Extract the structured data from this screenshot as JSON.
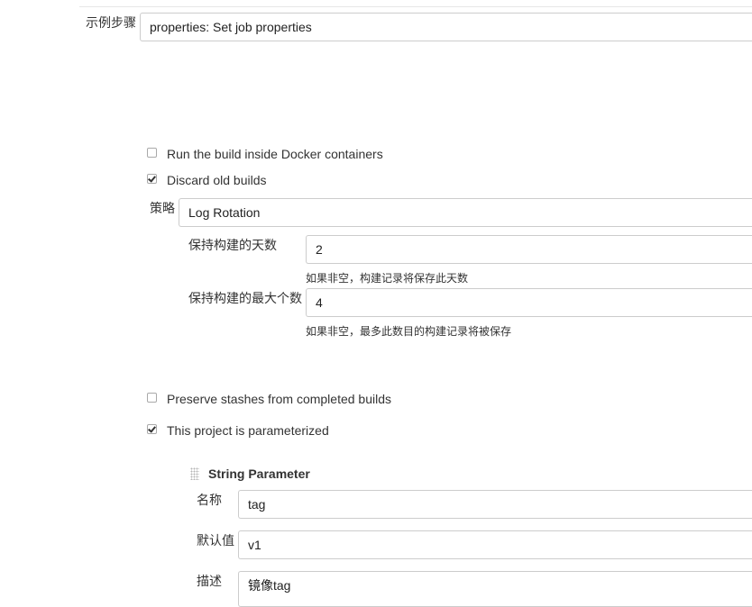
{
  "sample_step": {
    "label": "示例步骤",
    "value": "properties: Set job properties"
  },
  "options": {
    "docker": {
      "label": "Run the build inside Docker containers",
      "checked": false
    },
    "discard": {
      "label": "Discard old builds",
      "checked": true
    },
    "preserve_stashes": {
      "label": "Preserve stashes from completed builds",
      "checked": false
    },
    "parameterized": {
      "label": "This project is parameterized",
      "checked": true
    }
  },
  "discard_config": {
    "strategy_label": "策略",
    "strategy_value": "Log Rotation",
    "days_label": "保持构建的天数",
    "days_value": "2",
    "days_help": "如果非空，构建记录将保存此天数",
    "max_label": "保持构建的最大个数",
    "max_value": "4",
    "max_help": "如果非空，最多此数目的构建记录将被保存"
  },
  "string_parameter": {
    "title": "String Parameter",
    "name_label": "名称",
    "name_value": "tag",
    "default_label": "默认值",
    "default_value": "v1",
    "desc_label": "描述",
    "desc_value": "镜像tag"
  }
}
